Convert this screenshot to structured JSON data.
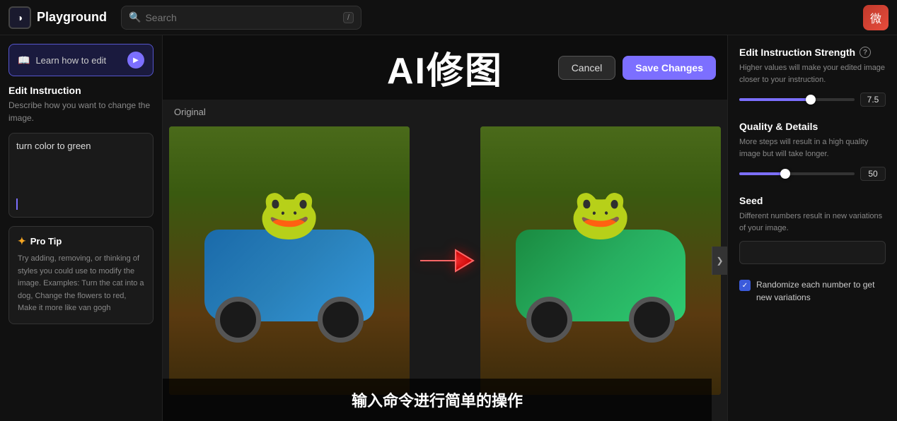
{
  "topbar": {
    "logo_icon": "◑",
    "logo_text": "Playground",
    "search_placeholder": "Search",
    "search_shortcut": "/",
    "user_avatar": "微"
  },
  "left_sidebar": {
    "learn_btn_label": "Learn how to edit",
    "edit_instruction_title": "Edit Instruction",
    "edit_instruction_desc": "Describe how you want to change the image.",
    "instruction_value": "turn color to green",
    "pro_tip_label": "Pro Tip",
    "pro_tip_text": "Try adding, removing, or thinking of styles you could use to modify the image. Examples: Turn the cat into a dog, Change the flowers to red, Make it more like van gogh"
  },
  "center": {
    "title": "AI修图",
    "cancel_label": "Cancel",
    "save_label": "Save Changes",
    "original_label": "Original",
    "subtitle": "输入命令进行简单的操作"
  },
  "right_sidebar": {
    "strength_title": "Edit Instruction Strength",
    "strength_desc": "Higher values will make your edited image closer to your instruction.",
    "strength_value": "7.5",
    "strength_percent": 62,
    "quality_title": "Quality & Details",
    "quality_desc": "More steps will result in a high quality image but will take longer.",
    "quality_value": "50",
    "quality_percent": 40,
    "seed_title": "Seed",
    "seed_desc": "Different numbers result in new variations of your image.",
    "seed_placeholder": "",
    "randomize_label": "Randomize each number to get new variations",
    "info_icon": "?"
  }
}
